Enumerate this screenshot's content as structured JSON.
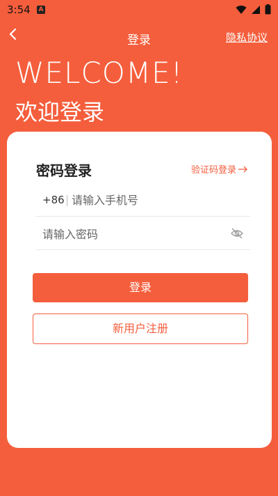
{
  "status_bar": {
    "time": "3:54",
    "notification_letter": "A"
  },
  "header": {
    "title": "登录",
    "privacy_link": "隐私协议"
  },
  "welcome": {
    "english": "WELCOME!",
    "chinese": "欢迎登录"
  },
  "login_card": {
    "title": "密码登录",
    "switch_link": "验证码登录",
    "country_code": "+86",
    "phone_placeholder": "请输入手机号",
    "password_placeholder": "请输入密码",
    "login_button": "登录",
    "register_button": "新用户注册"
  },
  "colors": {
    "accent": "#F45E3C",
    "card_background": "#FFFFFF"
  }
}
